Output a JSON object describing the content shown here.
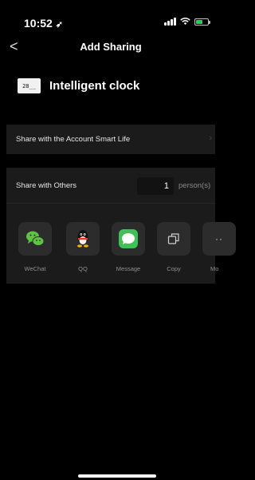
{
  "status_bar": {
    "time": "10:52"
  },
  "nav": {
    "back_symbol": "<",
    "title": "Add Sharing"
  },
  "device": {
    "icon_text": "28__",
    "name": "Intelligent clock"
  },
  "account_share": {
    "label": "Share with the Account Smart Life"
  },
  "others_share": {
    "label": "Share with Others",
    "count": "1",
    "unit": "person(s)"
  },
  "share_options": [
    {
      "label": "WeChat",
      "icon": "wechat-icon"
    },
    {
      "label": "QQ",
      "icon": "qq-icon"
    },
    {
      "label": "Message",
      "icon": "message-icon"
    },
    {
      "label": "Copy",
      "icon": "copy-icon"
    },
    {
      "label": "Mo",
      "icon": "more-icon"
    }
  ],
  "colors": {
    "background": "#000000",
    "card": "#1b1b1b",
    "wechat": "#5fc343",
    "message": "#40c157",
    "battery": "#35c759"
  }
}
